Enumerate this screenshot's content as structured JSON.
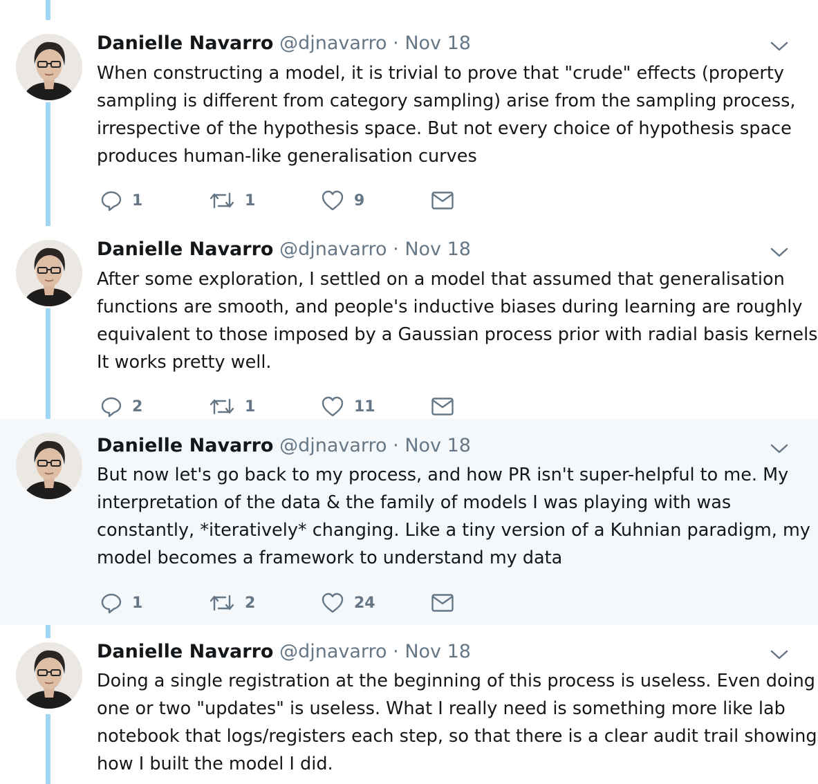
{
  "tweets": [
    {
      "author": {
        "name": "Danielle Navarro",
        "handle": "@djnavarro"
      },
      "separator": "·",
      "date": "Nov 18",
      "text_lines": [
        "When constructing a model, it is trivial to prove that \"crude\" effects (property",
        "sampling is different from category sampling) arise from the sampling process,",
        "irrespective of the hypothesis space. But not every choice of hypothesis space",
        "produces human-like generalisation curves"
      ],
      "stats": {
        "replies": "1",
        "retweets": "1",
        "likes": "9"
      }
    },
    {
      "author": {
        "name": "Danielle Navarro",
        "handle": "@djnavarro"
      },
      "separator": "·",
      "date": "Nov 18",
      "text_lines": [
        "After some exploration, I settled on a model that assumed that generalisation",
        "functions are smooth, and people's inductive biases during learning are roughly",
        "equivalent to those imposed by a Gaussian process prior with radial basis kernels.",
        "It works pretty well."
      ],
      "stats": {
        "replies": "2",
        "retweets": "1",
        "likes": "11"
      }
    },
    {
      "author": {
        "name": "Danielle Navarro",
        "handle": "@djnavarro"
      },
      "separator": "·",
      "date": "Nov 18",
      "text_lines": [
        "But now let's go back to my process, and how PR isn't super-helpful to me. My",
        "interpretation of the data & the family of models I was playing with was",
        "constantly, *iteratively* changing. Like a tiny version of a Kuhnian paradigm, my",
        "model becomes a framework to understand my data"
      ],
      "stats": {
        "replies": "1",
        "retweets": "2",
        "likes": "24"
      }
    },
    {
      "author": {
        "name": "Danielle Navarro",
        "handle": "@djnavarro"
      },
      "separator": "·",
      "date": "Nov 18",
      "text_lines": [
        "Doing a single registration at the beginning of this process is useless. Even doing",
        "one or two \"updates\" is useless. What I really need is something more like lab",
        "notebook that logs/registers each step, so that there is a clear audit trail showing",
        "how I built the model I did."
      ]
    }
  ],
  "icons": {
    "reply": "reply-icon",
    "retweet": "retweet-icon",
    "like": "heart-icon",
    "dm": "envelope-icon",
    "caret": "chevron-down-icon",
    "avatar": "avatar"
  },
  "colors": {
    "thread_line": "#9fd5f5",
    "highlight_bg": "#f5f8fa",
    "muted": "#657786",
    "text": "#14171a"
  }
}
